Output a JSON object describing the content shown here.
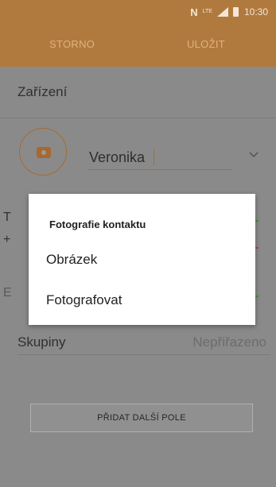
{
  "status_bar": {
    "nfc_glyph": "N",
    "network_label": "LTE",
    "time": "10:30"
  },
  "app_bar": {
    "cancel_label": "STORNO",
    "save_label": "ULOŽIT"
  },
  "form": {
    "device_label": "Zařízení",
    "name_value": "Veronika",
    "hidden_row_letters": [
      "T",
      "+",
      "E"
    ],
    "groups_label": "Skupiny",
    "groups_value": "Nepřiřazeno",
    "add_field_label": "PŘIDAT DALŠÍ POLE"
  },
  "popup": {
    "title": "Fotografie kontaktu",
    "items": [
      "Obrázek",
      "Fotografovat"
    ]
  },
  "colors": {
    "accent": "#b07a3e",
    "accent_dim": "#e0b37c",
    "dim_background": "#8a8a8a",
    "popup_background": "#ffffff"
  },
  "icons": {
    "avatar": "camera-icon",
    "dropdown": "chevron-down-icon",
    "signal": "signal-icon",
    "battery": "battery-icon"
  }
}
